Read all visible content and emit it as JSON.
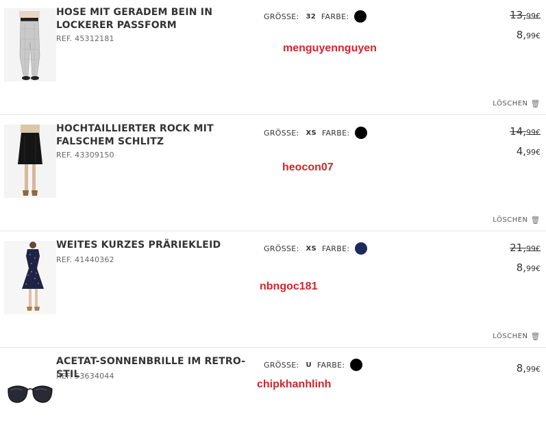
{
  "cart": {
    "size_label": "GRÖSSE:",
    "color_label": "FARBE:",
    "delete_label": "LÖSCHEN",
    "currency": "€",
    "items": [
      {
        "name": "HOSE MIT GERADEM BEIN IN LOCKERER PASSFORM",
        "ref": "REF. 45312181",
        "size": "32",
        "color_hex": "#000000",
        "old_price_main": "13,",
        "old_price_cents": "99€",
        "new_price_main": "8,",
        "new_price_cents": "99€",
        "watermark": "menguyennguyen",
        "image_icon": "trousers-product-image"
      },
      {
        "name": "HOCHTAILLIERTER ROCK MIT FALSCHEM SCHLITZ",
        "ref": "REF. 43309150",
        "size": "XS",
        "color_hex": "#000000",
        "old_price_main": "14,",
        "old_price_cents": "99€",
        "new_price_main": "4,",
        "new_price_cents": "99€",
        "watermark": "heocon07",
        "image_icon": "skirt-product-image"
      },
      {
        "name": "WEITES KURZES PRÄRIEKLEID",
        "ref": "REF. 41440362",
        "size": "XS",
        "color_hex": "#1f2a5c",
        "old_price_main": "21,",
        "old_price_cents": "99€",
        "new_price_main": "8,",
        "new_price_cents": "99€",
        "watermark": "nbngoc181",
        "image_icon": "dress-product-image"
      },
      {
        "name": "ACETAT-SONNENBRILLE IM RETRO-STIL",
        "ref": "REF. 53634044",
        "size": "U",
        "color_hex": "#000000",
        "new_price_main": "8,",
        "new_price_cents": "99€",
        "watermark": "chipkhanhlinh",
        "image_icon": "sunglasses-product-image"
      }
    ]
  }
}
